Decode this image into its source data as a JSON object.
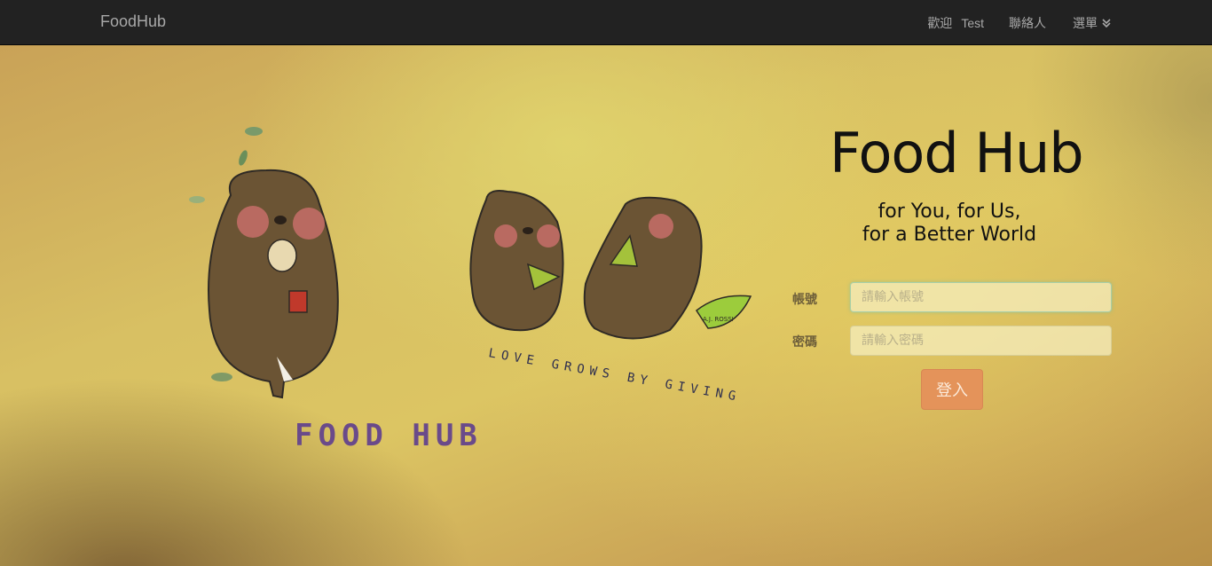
{
  "navbar": {
    "brand": "FoodHub",
    "welcome_prefix": "歡迎",
    "username": "Test",
    "contacts": "聯絡人",
    "menu": "選單"
  },
  "illustration": {
    "slogan": "LOVE GROWS BY GIVING",
    "logo_text": "FOOD HUB",
    "signature": "A.J. ROSSI"
  },
  "hero": {
    "title": "Food Hub",
    "tagline_line1": "for You, for Us,",
    "tagline_line2": "for a Better World"
  },
  "login_form": {
    "account_label": "帳號",
    "account_placeholder": "請輸入帳號",
    "password_label": "密碼",
    "password_placeholder": "請輸入密碼",
    "submit_label": "登入"
  },
  "colors": {
    "navbar_bg": "#222222",
    "login_button": "#e4935a",
    "background_accent": "#dcc563"
  }
}
